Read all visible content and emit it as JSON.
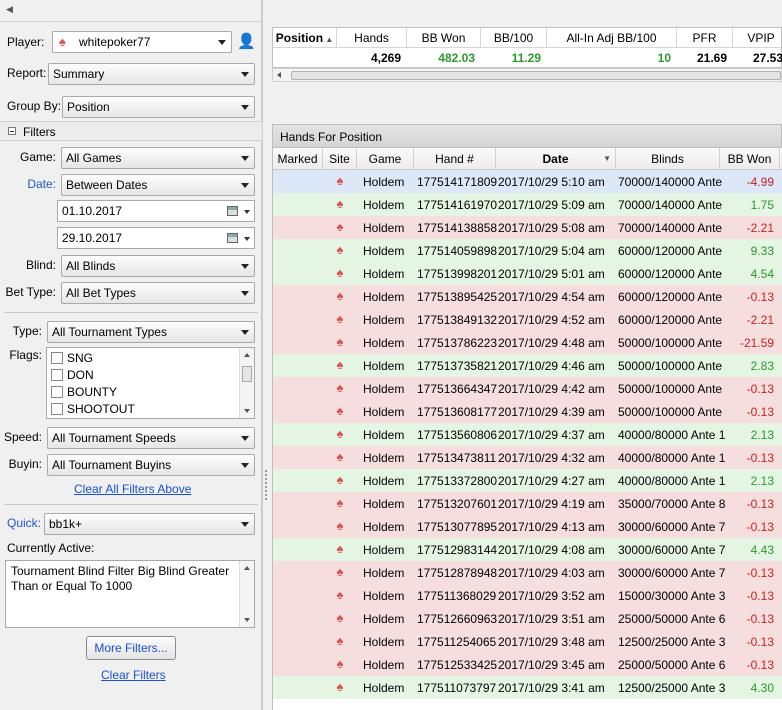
{
  "left": {
    "player_label": "Player:",
    "player_value": "whitepoker77",
    "report_label": "Report:",
    "report_value": "Summary",
    "groupby_label": "Group By:",
    "groupby_value": "Position",
    "filters_label": "Filters",
    "game_label": "Game:",
    "game_value": "All Games",
    "date_label": "Date:",
    "date_value": "Between Dates",
    "date_from": "01.10.2017",
    "date_to": "29.10.2017",
    "blind_label": "Blind:",
    "blind_value": "All Blinds",
    "bettype_label": "Bet Type:",
    "bettype_value": "All Bet Types",
    "type_label": "Type:",
    "type_value": "All Tournament Types",
    "flags_label": "Flags:",
    "flags": [
      "SNG",
      "DON",
      "BOUNTY",
      "SHOOTOUT"
    ],
    "speed_label": "Speed:",
    "speed_value": "All Tournament Speeds",
    "buyin_label": "Buyin:",
    "buyin_value": "All Tournament Buyins",
    "clear_above": "Clear All Filters Above",
    "quick_label": "Quick:",
    "quick_value": "bb1k+",
    "currently_active_label": "Currently Active:",
    "currently_active_text": "Tournament Blind Filter Big Blind Greater Than or Equal To 1000",
    "more_filters": "More Filters...",
    "clear_filters": "Clear Filters"
  },
  "stats": {
    "headers": [
      "Position",
      "Hands",
      "BB Won",
      "BB/100",
      "All-In Adj BB/100",
      "PFR",
      "VPIP"
    ],
    "values": [
      "",
      "4,269",
      "482.03",
      "11.29",
      "10",
      "21.69",
      "27.53"
    ]
  },
  "hands": {
    "title": "Hands For Position",
    "headers": [
      "Marked",
      "Site",
      "Game",
      "Hand #",
      "Date",
      "Blinds",
      "BB Won"
    ],
    "rows": [
      {
        "game": "Holdem",
        "hand": "177514171809",
        "date": "2017/10/29  5:10 am",
        "blinds": "70000/140000 Ante",
        "bb": "-4.99",
        "kind": "sel"
      },
      {
        "game": "Holdem",
        "hand": "177514161970",
        "date": "2017/10/29  5:09 am",
        "blinds": "70000/140000 Ante",
        "bb": "1.75",
        "kind": "pos"
      },
      {
        "game": "Holdem",
        "hand": "177514138858",
        "date": "2017/10/29  5:08 am",
        "blinds": "70000/140000 Ante",
        "bb": "-2.21",
        "kind": "neg"
      },
      {
        "game": "Holdem",
        "hand": "177514059898",
        "date": "2017/10/29  5:04 am",
        "blinds": "60000/120000 Ante",
        "bb": "9.33",
        "kind": "pos"
      },
      {
        "game": "Holdem",
        "hand": "177513998201",
        "date": "2017/10/29  5:01 am",
        "blinds": "60000/120000 Ante",
        "bb": "4.54",
        "kind": "pos"
      },
      {
        "game": "Holdem",
        "hand": "177513895425",
        "date": "2017/10/29  4:54 am",
        "blinds": "60000/120000 Ante",
        "bb": "-0.13",
        "kind": "neg"
      },
      {
        "game": "Holdem",
        "hand": "177513849132",
        "date": "2017/10/29  4:52 am",
        "blinds": "60000/120000 Ante",
        "bb": "-2.21",
        "kind": "neg"
      },
      {
        "game": "Holdem",
        "hand": "177513786223",
        "date": "2017/10/29  4:48 am",
        "blinds": "50000/100000 Ante",
        "bb": "-21.59",
        "kind": "neg"
      },
      {
        "game": "Holdem",
        "hand": "177513735821",
        "date": "2017/10/29  4:46 am",
        "blinds": "50000/100000 Ante",
        "bb": "2.83",
        "kind": "pos"
      },
      {
        "game": "Holdem",
        "hand": "177513664347",
        "date": "2017/10/29  4:42 am",
        "blinds": "50000/100000 Ante",
        "bb": "-0.13",
        "kind": "neg"
      },
      {
        "game": "Holdem",
        "hand": "177513608177",
        "date": "2017/10/29  4:39 am",
        "blinds": "50000/100000 Ante",
        "bb": "-0.13",
        "kind": "neg"
      },
      {
        "game": "Holdem",
        "hand": "177513560806",
        "date": "2017/10/29  4:37 am",
        "blinds": "40000/80000 Ante 1",
        "bb": "2.13",
        "kind": "pos"
      },
      {
        "game": "Holdem",
        "hand": "177513473811",
        "date": "2017/10/29  4:32 am",
        "blinds": "40000/80000 Ante 1",
        "bb": "-0.13",
        "kind": "neg"
      },
      {
        "game": "Holdem",
        "hand": "177513372800",
        "date": "2017/10/29  4:27 am",
        "blinds": "40000/80000 Ante 1",
        "bb": "2.13",
        "kind": "pos"
      },
      {
        "game": "Holdem",
        "hand": "177513207601",
        "date": "2017/10/29  4:19 am",
        "blinds": "35000/70000 Ante 8",
        "bb": "-0.13",
        "kind": "neg"
      },
      {
        "game": "Holdem",
        "hand": "177513077895",
        "date": "2017/10/29  4:13 am",
        "blinds": "30000/60000 Ante 7",
        "bb": "-0.13",
        "kind": "neg"
      },
      {
        "game": "Holdem",
        "hand": "177512983144",
        "date": "2017/10/29  4:08 am",
        "blinds": "30000/60000 Ante 7",
        "bb": "4.43",
        "kind": "pos"
      },
      {
        "game": "Holdem",
        "hand": "177512878948",
        "date": "2017/10/29  4:03 am",
        "blinds": "30000/60000 Ante 7",
        "bb": "-0.13",
        "kind": "neg"
      },
      {
        "game": "Holdem",
        "hand": "177511368029",
        "date": "2017/10/29  3:52 am",
        "blinds": "15000/30000 Ante 3",
        "bb": "-0.13",
        "kind": "neg"
      },
      {
        "game": "Holdem",
        "hand": "177512660963",
        "date": "2017/10/29  3:51 am",
        "blinds": "25000/50000 Ante 6",
        "bb": "-0.13",
        "kind": "neg"
      },
      {
        "game": "Holdem",
        "hand": "177511254065",
        "date": "2017/10/29  3:48 am",
        "blinds": "12500/25000 Ante 3",
        "bb": "-0.13",
        "kind": "neg"
      },
      {
        "game": "Holdem",
        "hand": "177512533425",
        "date": "2017/10/29  3:45 am",
        "blinds": "25000/50000 Ante 6",
        "bb": "-0.13",
        "kind": "neg"
      },
      {
        "game": "Holdem",
        "hand": "177511073797",
        "date": "2017/10/29  3:41 am",
        "blinds": "12500/25000 Ante 3",
        "bb": "4.30",
        "kind": "pos"
      }
    ]
  },
  "colors": {
    "positive": "#2a9a2a",
    "negative": "#cc1f1f",
    "link": "#1a4fd6",
    "site_icon": "#d9534f"
  }
}
